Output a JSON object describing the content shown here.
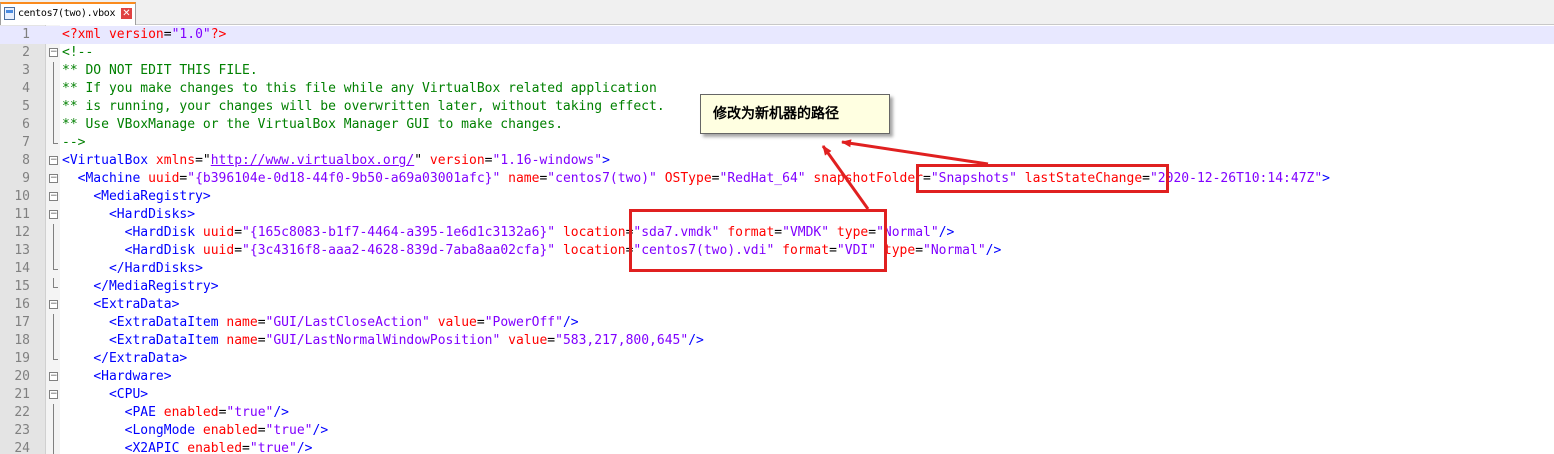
{
  "tab": {
    "filename": "centos7(two).vbox",
    "close_glyph": "✕",
    "icon": "document-icon"
  },
  "colors": {
    "tag": "#0000ff",
    "attribute": "#ff0000",
    "value": "#8000ff",
    "comment": "#008000",
    "annotation_red": "#e02020",
    "note_background": "#ffffe1",
    "current_line": "#e8e8ff"
  },
  "annotation": {
    "note_text": "修改为新机器的路径"
  },
  "lines": [
    {
      "n": "1"
    },
    {
      "n": "2"
    },
    {
      "n": "3"
    },
    {
      "n": "4"
    },
    {
      "n": "5"
    },
    {
      "n": "6"
    },
    {
      "n": "7"
    },
    {
      "n": "8"
    },
    {
      "n": "9"
    },
    {
      "n": "10"
    },
    {
      "n": "11"
    },
    {
      "n": "12"
    },
    {
      "n": "13"
    },
    {
      "n": "14"
    },
    {
      "n": "15"
    },
    {
      "n": "16"
    },
    {
      "n": "17"
    },
    {
      "n": "18"
    },
    {
      "n": "19"
    },
    {
      "n": "20"
    },
    {
      "n": "21"
    },
    {
      "n": "22"
    },
    {
      "n": "23"
    },
    {
      "n": "24"
    }
  ],
  "code": {
    "l1": {
      "open": "<?xml ",
      "a1": "version",
      "eq1": "=",
      "v1": "\"1.0\"",
      "close": "?>"
    },
    "l2": {
      "text": "<!--"
    },
    "l3": {
      "text": "** DO NOT EDIT THIS FILE."
    },
    "l4": {
      "text": "** If you make changes to this file while any VirtualBox related application"
    },
    "l5": {
      "text": "** is running, your changes will be overwritten later, without taking effect."
    },
    "l6": {
      "text": "** Use VBoxManage or the VirtualBox Manager GUI to make changes."
    },
    "l7": {
      "text": "-->"
    },
    "l8": {
      "open": "<VirtualBox ",
      "a1": "xmlns",
      "eq1": "=\"",
      "v1": "http://www.virtualbox.org/",
      "q1": "\" ",
      "a2": "version",
      "eq2": "=",
      "v2": "\"1.16-windows\"",
      "close": ">"
    },
    "l9": {
      "open": "<Machine ",
      "a1": "uuid",
      "v1": "\"{b396104e-0d18-44f0-9b50-a69a03001afc}\"",
      "a2": "name",
      "v2": "\"centos7(two)\"",
      "a3": "OSType",
      "v3": "\"RedHat_64\"",
      "a4": "snapshotFolder",
      "v4": "\"Snapshots\"",
      "a5": "lastStateChange",
      "v5": "\"2020-12-26T10:14:47Z\"",
      "close": ">",
      "eq": "="
    },
    "l10": {
      "open": "<MediaRegistry",
      "close": ">"
    },
    "l11": {
      "open": "<HardDisks",
      "close": ">"
    },
    "l12": {
      "open": "<HardDisk ",
      "a1": "uuid",
      "v1": "\"{165c8083-b1f7-4464-a395-1e6d1c3132a6}\"",
      "a2": "location",
      "v2": "\"sda7.vmdk\"",
      "a3": "format",
      "v3": "\"VMDK\"",
      "a4": "type",
      "v4": "\"Normal\"",
      "close": "/>",
      "eq": "="
    },
    "l13": {
      "open": "<HardDisk ",
      "a1": "uuid",
      "v1": "\"{3c4316f8-aaa2-4628-839d-7aba8aa02cfa}\"",
      "a2": "location",
      "v2": "\"centos7(two).vdi\"",
      "a3": "format",
      "v3": "\"VDI\"",
      "a4": "type",
      "v4": "\"Normal\"",
      "close": "/>",
      "eq": "="
    },
    "l14": {
      "open": "</HardDisks",
      "close": ">"
    },
    "l15": {
      "open": "</MediaRegistry",
      "close": ">"
    },
    "l16": {
      "open": "<ExtraData",
      "close": ">"
    },
    "l17": {
      "open": "<ExtraDataItem ",
      "a1": "name",
      "v1": "\"GUI/LastCloseAction\"",
      "a2": "value",
      "v2": "\"PowerOff\"",
      "close": "/>",
      "eq": "="
    },
    "l18": {
      "open": "<ExtraDataItem ",
      "a1": "name",
      "v1": "\"GUI/LastNormalWindowPosition\"",
      "a2": "value",
      "v2": "\"583,217,800,645\"",
      "close": "/>",
      "eq": "="
    },
    "l19": {
      "open": "</ExtraData",
      "close": ">"
    },
    "l20": {
      "open": "<Hardware",
      "close": ">"
    },
    "l21": {
      "open": "<CPU",
      "close": ">"
    },
    "l22": {
      "open": "<PAE ",
      "a1": "enabled",
      "v1": "\"true\"",
      "close": "/>",
      "eq": "="
    },
    "l23": {
      "open": "<LongMode ",
      "a1": "enabled",
      "v1": "\"true\"",
      "close": "/>",
      "eq": "="
    },
    "l24": {
      "open": "<X2APIC ",
      "a1": "enabled",
      "v1": "\"true\"",
      "close": "/>",
      "eq": "="
    }
  }
}
